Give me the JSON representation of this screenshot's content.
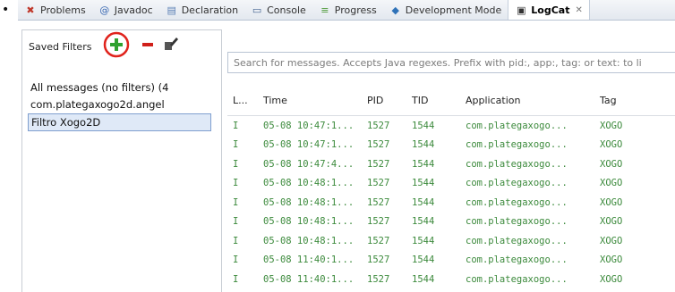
{
  "bullet": "•",
  "tabs": [
    {
      "label": "Problems",
      "icon": "problems-icon",
      "glyph": "✖",
      "color": "#c0392b"
    },
    {
      "label": "Javadoc",
      "icon": "javadoc-icon",
      "glyph": "@",
      "color": "#3d6bb3"
    },
    {
      "label": "Declaration",
      "icon": "declaration-icon",
      "glyph": "▤",
      "color": "#5a7fb5"
    },
    {
      "label": "Console",
      "icon": "console-icon",
      "glyph": "▭",
      "color": "#40618f"
    },
    {
      "label": "Progress",
      "icon": "progress-icon",
      "glyph": "≡",
      "color": "#4e9a3a"
    },
    {
      "label": "Development Mode",
      "icon": "development-mode-icon",
      "glyph": "◆",
      "color": "#2f72b8"
    },
    {
      "label": "LogCat",
      "icon": "logcat-icon",
      "glyph": "▣",
      "color": "#333333",
      "close": "✕"
    }
  ],
  "filters": {
    "title": "Saved Filters",
    "add_glyph": "+",
    "remove_glyph": "−",
    "edit_glyph": "✎",
    "items": [
      {
        "label": "All messages (no filters) (4"
      },
      {
        "label": "com.plategaxogo2d.angel"
      },
      {
        "label": "Filtro Xogo2D"
      }
    ]
  },
  "search": {
    "placeholder": "Search for messages. Accepts Java regexes. Prefix with pid:, app:, tag: or text: to li"
  },
  "table": {
    "headers": [
      "L...",
      "Time",
      "PID",
      "TID",
      "Application",
      "Tag"
    ],
    "rows": [
      [
        "I",
        "05-08 10:47:1...",
        "1527",
        "1544",
        "com.plategaxogo...",
        "XOGO"
      ],
      [
        "I",
        "05-08 10:47:1...",
        "1527",
        "1544",
        "com.plategaxogo...",
        "XOGO"
      ],
      [
        "I",
        "05-08 10:47:4...",
        "1527",
        "1544",
        "com.plategaxogo...",
        "XOGO"
      ],
      [
        "I",
        "05-08 10:48:1...",
        "1527",
        "1544",
        "com.plategaxogo...",
        "XOGO"
      ],
      [
        "I",
        "05-08 10:48:1...",
        "1527",
        "1544",
        "com.plategaxogo...",
        "XOGO"
      ],
      [
        "I",
        "05-08 10:48:1...",
        "1527",
        "1544",
        "com.plategaxogo...",
        "XOGO"
      ],
      [
        "I",
        "05-08 10:48:1...",
        "1527",
        "1544",
        "com.plategaxogo...",
        "XOGO"
      ],
      [
        "I",
        "05-08 11:40:1...",
        "1527",
        "1544",
        "com.plategaxogo...",
        "XOGO"
      ],
      [
        "I",
        "05-08 11:40:1...",
        "1527",
        "1544",
        "com.plategaxogo...",
        "XOGO"
      ]
    ]
  },
  "colors": {
    "log_text": "#3c8a3c",
    "add_green": "#2fa12f",
    "remove_red": "#d0201a",
    "highlight_circle": "#e0231c"
  }
}
